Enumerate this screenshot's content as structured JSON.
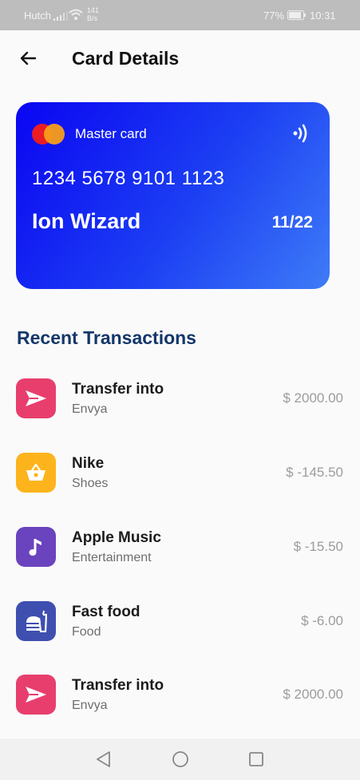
{
  "status_bar": {
    "carrier": "Hutch",
    "speed_value": "141",
    "speed_unit": "B/s",
    "battery": "77%",
    "time": "10:31"
  },
  "header": {
    "title": "Card Details",
    "back_icon": "arrow-left"
  },
  "card": {
    "brand": "Master card",
    "number": "1234 5678 9101 1123",
    "holder": "Ion Wizard",
    "expiry": "11/22",
    "gradient_start": "#0a05f2",
    "gradient_end": "#3e7cf7"
  },
  "transactions": {
    "title": "Recent Transactions",
    "items": [
      {
        "name": "Transfer into",
        "subtitle": "Envya",
        "amount": "$ 2000.00",
        "icon": "send-icon",
        "color": "#e83e6d"
      },
      {
        "name": "Nike",
        "subtitle": "Shoes",
        "amount": "$ -145.50",
        "icon": "basket-icon",
        "color": "#fdb41c"
      },
      {
        "name": "Apple Music",
        "subtitle": "Entertainment",
        "amount": "$ -15.50",
        "icon": "music-note-icon",
        "color": "#6a43be"
      },
      {
        "name": "Fast food",
        "subtitle": "Food",
        "amount": "$ -6.00",
        "icon": "fast-food-icon",
        "color": "#3f4fb0"
      },
      {
        "name": "Transfer into",
        "subtitle": "Envya",
        "amount": "$ 2000.00",
        "icon": "send-icon",
        "color": "#e83e6d"
      }
    ]
  },
  "nav_bar": {
    "buttons": [
      "back-triangle",
      "home-circle",
      "recents-square"
    ]
  }
}
